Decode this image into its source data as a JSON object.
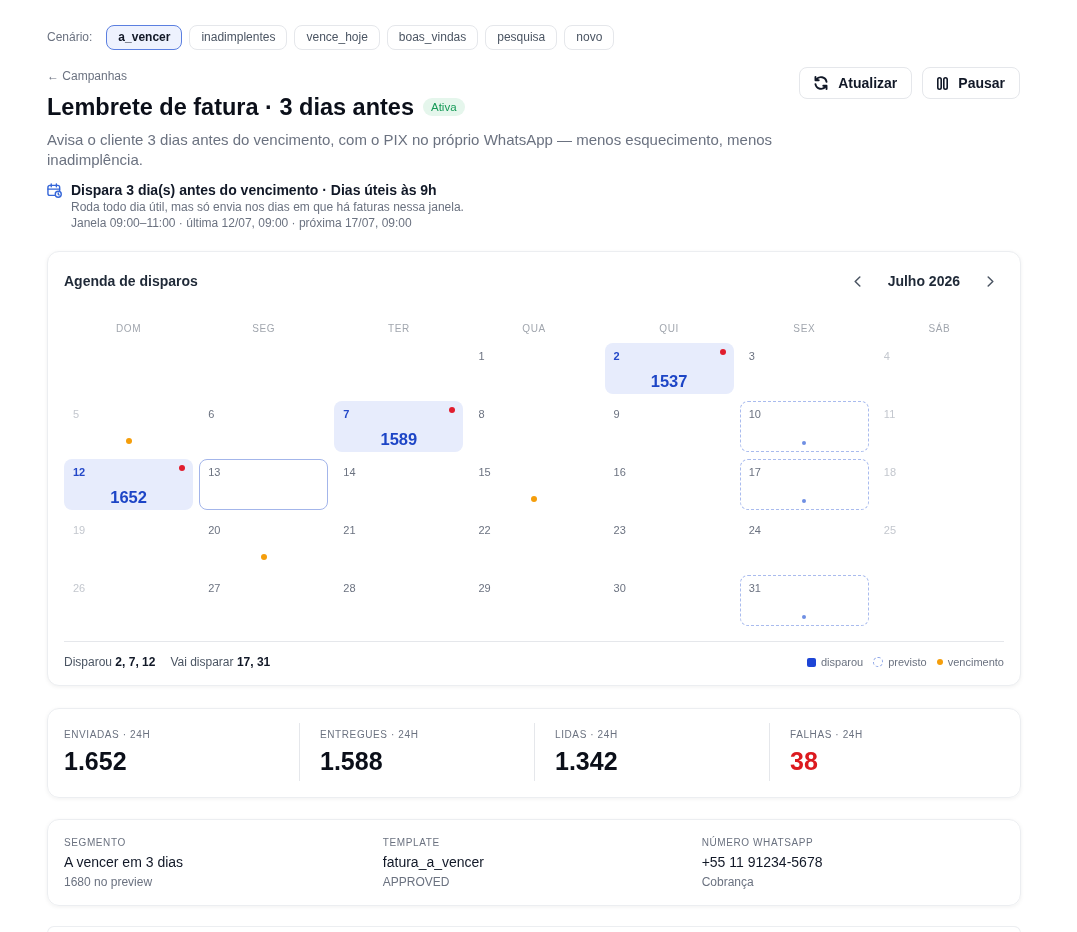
{
  "scenario": {
    "label": "Cenário:",
    "options": [
      {
        "label": "a_vencer",
        "selected": true
      },
      {
        "label": "inadimplentes",
        "selected": false
      },
      {
        "label": "vence_hoje",
        "selected": false
      },
      {
        "label": "boas_vindas",
        "selected": false
      },
      {
        "label": "pesquisa",
        "selected": false
      },
      {
        "label": "novo",
        "selected": false
      }
    ]
  },
  "header": {
    "back_link": "← Campanhas",
    "title": "Lembrete de fatura · 3 dias antes",
    "status": {
      "label": "Ativa",
      "kind": "active"
    },
    "actions": [
      {
        "label": "Atualizar",
        "kind": "refresh"
      },
      {
        "label": "Pausar",
        "kind": "pause"
      }
    ]
  },
  "description": "Avisa o cliente 3 dias antes do vencimento, com o PIX no próprio WhatsApp — menos esquecimento, menos inadimplência.",
  "schedule": {
    "summary": "Dispara 3 dia(s) antes do vencimento · Dias úteis às 9h",
    "note": "Roda todo dia útil, mas só envia nos dias em que há faturas nessa janela.",
    "window": "Janela 09:00–11:00 · última 12/07, 09:00 · próxima 17/07, 09:00"
  },
  "calendar": {
    "title": "Agenda de disparos",
    "month": "Julho 2026",
    "weekdays": [
      "DOM",
      "SEG",
      "TER",
      "QUA",
      "QUI",
      "SEX",
      "SÁB"
    ],
    "days": [
      {
        "kind": "empty"
      },
      {
        "kind": "empty"
      },
      {
        "kind": "empty"
      },
      {
        "day": "1",
        "kind": "plain",
        "weekend": false,
        "due": false
      },
      {
        "day": "2",
        "kind": "fired",
        "count": "1537",
        "due": false
      },
      {
        "day": "3",
        "kind": "plain",
        "weekend": false,
        "due": false
      },
      {
        "day": "4",
        "kind": "plain",
        "weekend": true,
        "due": false
      },
      {
        "day": "5",
        "kind": "plain",
        "weekend": true,
        "due": true
      },
      {
        "day": "6",
        "kind": "plain",
        "weekend": false,
        "due": false
      },
      {
        "day": "7",
        "kind": "fired",
        "count": "1589",
        "due": false
      },
      {
        "day": "8",
        "kind": "plain",
        "weekend": false,
        "due": false
      },
      {
        "day": "9",
        "kind": "plain",
        "weekend": false,
        "due": false
      },
      {
        "day": "10",
        "kind": "planned",
        "weekend": false,
        "due": false
      },
      {
        "day": "11",
        "kind": "plain",
        "weekend": true,
        "due": false
      },
      {
        "day": "12",
        "kind": "fired",
        "count": "1652",
        "due": false
      },
      {
        "day": "13",
        "kind": "today",
        "weekend": false,
        "due": false
      },
      {
        "day": "14",
        "kind": "plain",
        "weekend": false,
        "due": false
      },
      {
        "day": "15",
        "kind": "plain",
        "weekend": false,
        "due": true
      },
      {
        "day": "16",
        "kind": "plain",
        "weekend": false,
        "due": false
      },
      {
        "day": "17",
        "kind": "planned",
        "weekend": false,
        "due": false
      },
      {
        "day": "18",
        "kind": "plain",
        "weekend": true,
        "due": false
      },
      {
        "day": "19",
        "kind": "plain",
        "weekend": true,
        "due": false
      },
      {
        "day": "20",
        "kind": "plain",
        "weekend": false,
        "due": true
      },
      {
        "day": "21",
        "kind": "plain",
        "weekend": false,
        "due": false
      },
      {
        "day": "22",
        "kind": "plain",
        "weekend": false,
        "due": false
      },
      {
        "day": "23",
        "kind": "plain",
        "weekend": false,
        "due": false
      },
      {
        "day": "24",
        "kind": "plain",
        "weekend": false,
        "due": false
      },
      {
        "day": "25",
        "kind": "plain",
        "weekend": true,
        "due": false
      },
      {
        "day": "26",
        "kind": "plain",
        "weekend": true,
        "due": false
      },
      {
        "day": "27",
        "kind": "plain",
        "weekend": false,
        "due": false
      },
      {
        "day": "28",
        "kind": "plain",
        "weekend": false,
        "due": false
      },
      {
        "day": "29",
        "kind": "plain",
        "weekend": false,
        "due": false
      },
      {
        "day": "30",
        "kind": "plain",
        "weekend": false,
        "due": false
      },
      {
        "day": "31",
        "kind": "planned",
        "weekend": false,
        "due": false
      }
    ],
    "fired_summary": "Disparou **2, 7, 12**",
    "planned_summary": "Vai disparar **17, 31**",
    "legend": [
      {
        "label": "disparou",
        "kind": "fired"
      },
      {
        "label": "previsto",
        "kind": "planned"
      },
      {
        "label": "vencimento",
        "kind": "due"
      }
    ]
  },
  "stats": [
    {
      "label": "ENVIADAS · 24H",
      "value": "1.652",
      "kind": "normal"
    },
    {
      "label": "ENTREGUES · 24H",
      "value": "1.588",
      "kind": "normal"
    },
    {
      "label": "LIDAS · 24H",
      "value": "1.342",
      "kind": "normal"
    },
    {
      "label": "FALHAS · 24H",
      "value": "38",
      "kind": "error"
    }
  ],
  "details": [
    {
      "label": "SEGMENTO",
      "value": "A vencer em 3 dias",
      "note": "1680 no preview"
    },
    {
      "label": "TEMPLATE",
      "value": "fatura_a_vencer",
      "note": "APPROVED"
    },
    {
      "label": "NÚMERO WHATSAPP",
      "value": "+55 11 91234-5678",
      "note": "Cobrança"
    }
  ]
}
